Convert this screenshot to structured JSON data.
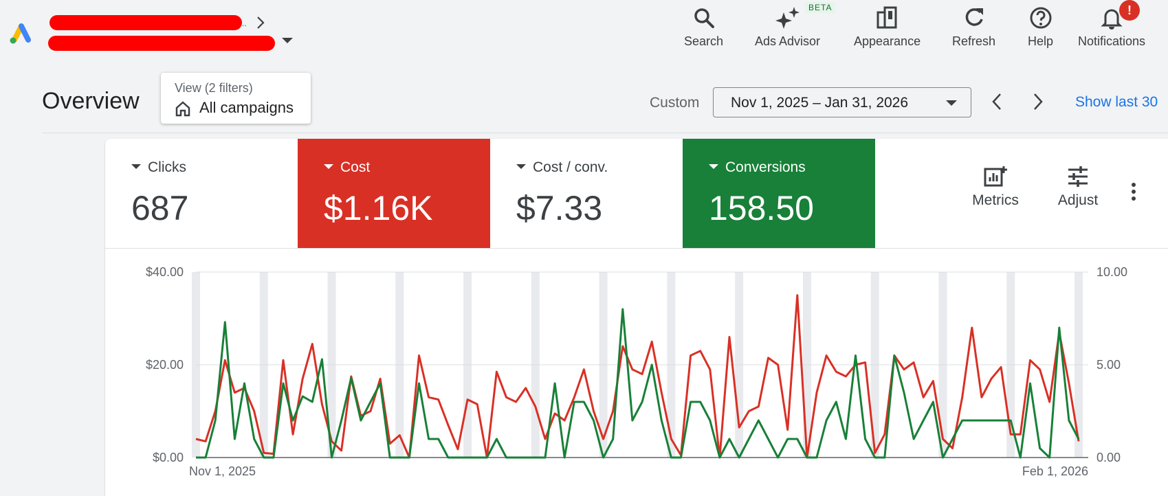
{
  "topbar": {
    "tools": [
      {
        "name": "search",
        "label": "Search"
      },
      {
        "name": "ads-advisor",
        "label": "Ads Advisor"
      },
      {
        "name": "appearance",
        "label": "Appearance"
      },
      {
        "name": "refresh",
        "label": "Refresh"
      },
      {
        "name": "help",
        "label": "Help"
      },
      {
        "name": "notifications",
        "label": "Notifications"
      }
    ],
    "beta_badge": "BETA",
    "notification_badge": "!",
    "account_ellipsis": "..."
  },
  "overview": {
    "title": "Overview",
    "view_filter": {
      "subtitle": "View (2 filters)",
      "value": "All campaigns"
    },
    "date_mode": "Custom",
    "date_range": "Nov 1, 2025 – Jan 31, 2026",
    "show_last": "Show last 30"
  },
  "metrics": [
    {
      "name": "Clicks",
      "value": "687",
      "selected": false,
      "color": "#3c4043"
    },
    {
      "name": "Cost",
      "value": "$1.16K",
      "selected": true,
      "color": "#d93025"
    },
    {
      "name": "Cost / conv.",
      "value": "$7.33",
      "selected": false,
      "color": "#3c4043"
    },
    {
      "name": "Conversions",
      "value": "158.50",
      "selected": true,
      "color": "#188038"
    }
  ],
  "card_tools": {
    "metrics_label": "Metrics",
    "adjust_label": "Adjust"
  },
  "chart_data": {
    "type": "line",
    "x_start_label": "Nov 1, 2025",
    "x_end_label": "Feb 1, 2026",
    "left_axis": {
      "ticks": [
        "$0.00",
        "$20.00",
        "$40.00"
      ],
      "ylim": [
        0,
        40
      ]
    },
    "right_axis": {
      "ticks": [
        "0.00",
        "5.00",
        "10.00"
      ],
      "ylim": [
        0,
        10
      ]
    },
    "grid": true,
    "weekend_bands": true,
    "series": [
      {
        "name": "Cost",
        "axis": "left",
        "color": "#d93025",
        "values": [
          4,
          3.5,
          10,
          21,
          14,
          15,
          10,
          1,
          0.8,
          21,
          5,
          17,
          24.5,
          11.5,
          3.5,
          1.5,
          17.5,
          9,
          10,
          17,
          3,
          4.8,
          0,
          22,
          13,
          12.5,
          7,
          1.8,
          12.5,
          11.5,
          0,
          18.5,
          13,
          12,
          15,
          11,
          4,
          9.5,
          8,
          13,
          19,
          10,
          4,
          10,
          24,
          19,
          18,
          25,
          14,
          4,
          0.5,
          22,
          23,
          19,
          0,
          26,
          6.5,
          10,
          11,
          21.5,
          20,
          6,
          35,
          0,
          14,
          22,
          18.5,
          17.5,
          20,
          20.5,
          1,
          5,
          22,
          19,
          20.5,
          13,
          16.5,
          4,
          2,
          13,
          28,
          13,
          17,
          19.5,
          5,
          5,
          21,
          19,
          12,
          27,
          16,
          3.5
        ]
      },
      {
        "name": "Conversions",
        "axis": "right",
        "color": "#188038",
        "values": [
          0,
          0,
          2,
          7.3,
          1,
          4,
          1,
          0,
          0,
          4,
          2,
          3.3,
          3,
          5.3,
          0,
          2,
          4.3,
          2,
          3,
          4,
          0,
          0,
          0,
          4,
          1,
          1,
          0,
          0,
          0,
          0,
          0,
          1,
          0,
          0,
          0,
          0,
          0,
          4,
          0,
          3,
          3,
          2,
          0,
          1,
          8,
          2,
          3,
          5,
          2,
          0,
          0,
          3,
          3,
          2,
          0,
          1,
          0,
          1,
          2,
          1,
          0,
          1,
          1,
          0,
          0,
          2,
          3,
          1,
          5.5,
          1,
          0,
          0,
          5.5,
          3.5,
          1,
          2,
          3,
          0,
          1,
          2,
          2,
          2,
          2,
          2,
          2,
          0,
          4,
          0.5,
          0,
          7,
          2,
          1
        ]
      }
    ]
  }
}
